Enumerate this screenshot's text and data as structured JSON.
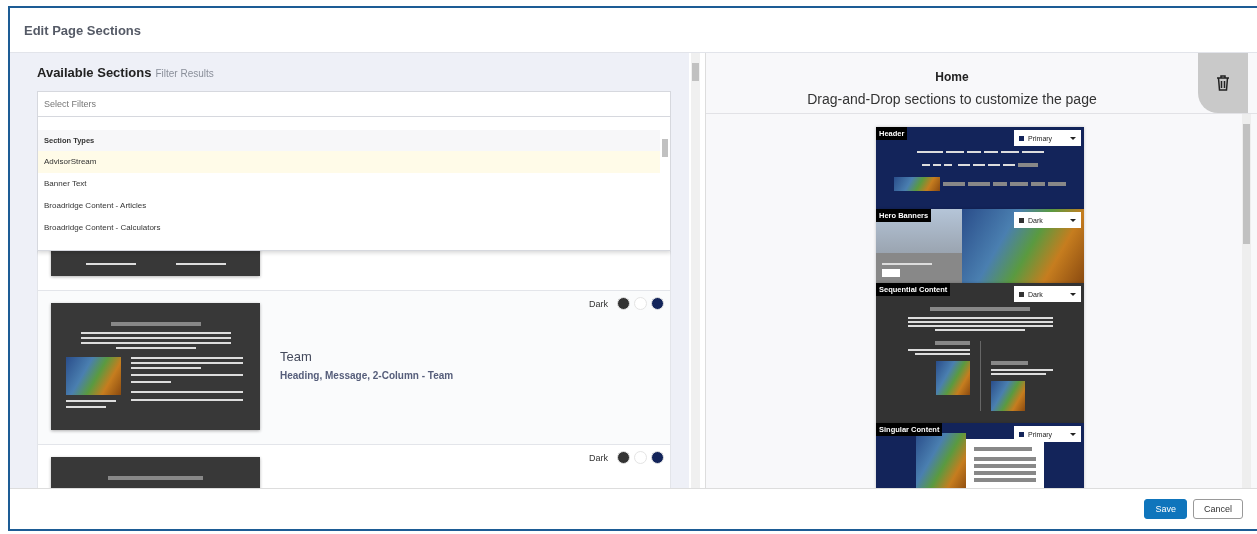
{
  "window": {
    "title": "Edit Page Sections"
  },
  "available_sections": {
    "title": "Available Sections",
    "subtitle": "Filter Results",
    "filter": {
      "placeholder": "Select Filters"
    },
    "dropdown": {
      "group": "Section Types",
      "options": [
        {
          "label": "AdvisorStream",
          "selected": true
        },
        {
          "label": "Banner Text",
          "selected": false
        },
        {
          "label": "Broadridge Content - Articles",
          "selected": false
        },
        {
          "label": "Broadridge Content - Calculators",
          "selected": false
        }
      ]
    },
    "cards": [
      {
        "kind": "columns"
      },
      {
        "kind": "team",
        "title": "Team",
        "description": "Heading, Message, 2-Column - Team",
        "theme": "Dark",
        "swatches": [
          {
            "color": "#333333"
          },
          {
            "color": "#ffffff"
          },
          {
            "color": "#13245a"
          }
        ]
      },
      {
        "kind": "banner",
        "theme": "Dark",
        "swatches": [
          {
            "color": "#333333"
          },
          {
            "color": "#ffffff"
          },
          {
            "color": "#13245a"
          }
        ]
      }
    ]
  },
  "page_preview": {
    "title": "Home",
    "subtitle": "Drag-and-Drop sections to customize the page",
    "sections": [
      {
        "kind": "header",
        "label": "Header",
        "theme": "Primary",
        "color": "#13245a"
      },
      {
        "kind": "hero",
        "label": "Hero Banners",
        "theme": "Dark",
        "color": "#333333"
      },
      {
        "kind": "sequential",
        "label": "Sequential Content",
        "theme": "Dark",
        "color": "#333333"
      },
      {
        "kind": "singular",
        "label": "Singular Content",
        "theme": "Primary",
        "color": "#13245a"
      }
    ]
  },
  "buttons": [
    {
      "label": "Save",
      "kind": "primary"
    },
    {
      "label": "Cancel",
      "kind": "secondary"
    }
  ]
}
